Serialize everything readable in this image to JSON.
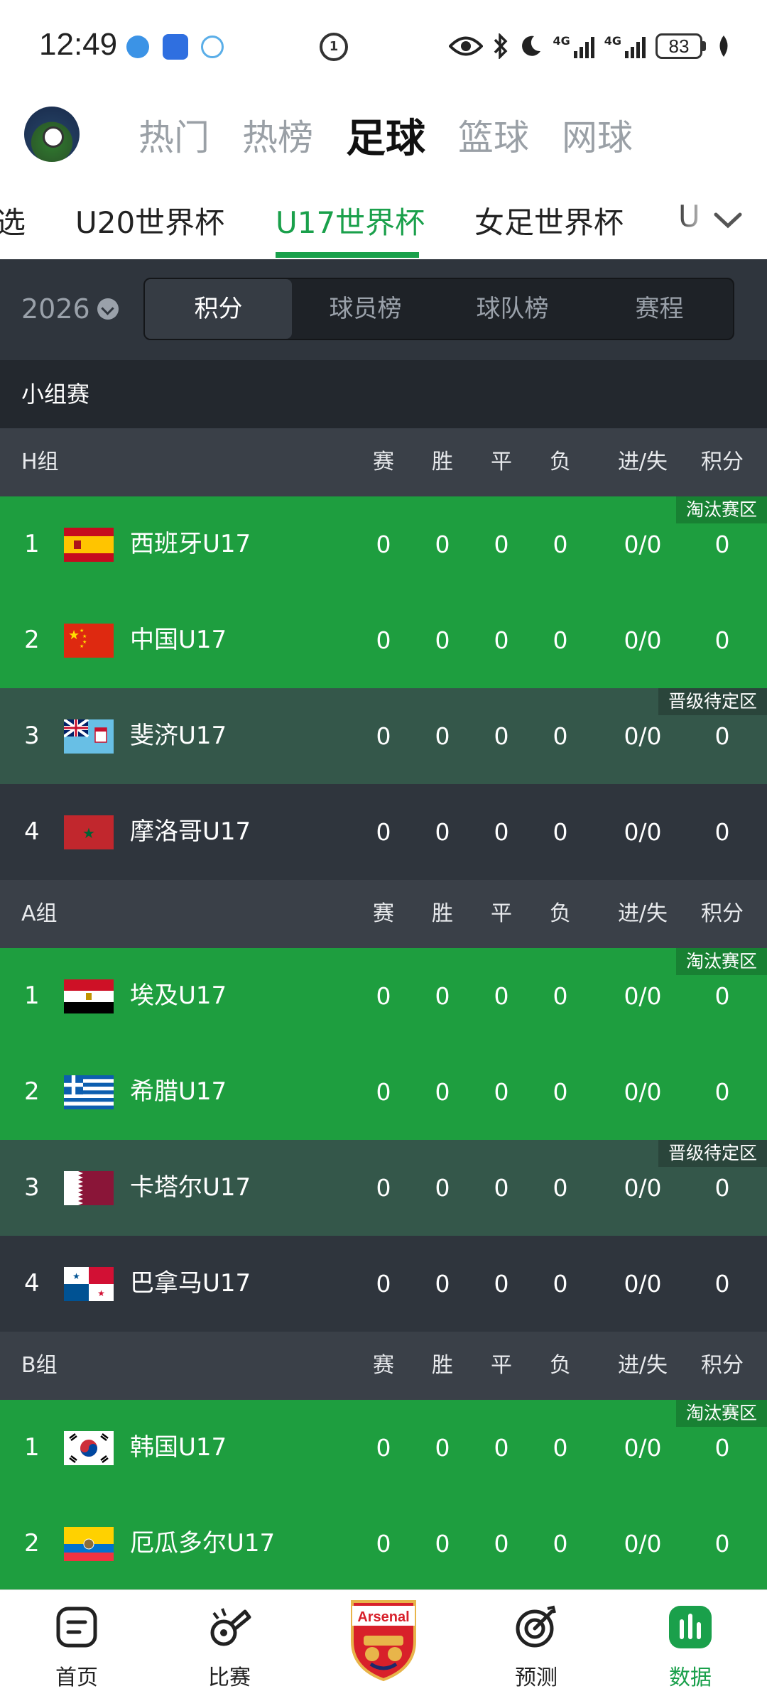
{
  "status_bar": {
    "time": "12:49",
    "battery": "83",
    "network1": "4G",
    "network2": "4G"
  },
  "top_nav": {
    "tabs": [
      {
        "label": "热门",
        "active": false
      },
      {
        "label": "热榜",
        "active": false
      },
      {
        "label": "足球",
        "active": true
      },
      {
        "label": "篮球",
        "active": false
      },
      {
        "label": "网球",
        "active": false
      }
    ]
  },
  "league_tabs": {
    "items": [
      {
        "label": "选",
        "active": false
      },
      {
        "label": "U20世界杯",
        "active": false
      },
      {
        "label": "U17世界杯",
        "active": true
      },
      {
        "label": "女足世界杯",
        "active": false
      },
      {
        "label": "U",
        "active": false
      }
    ]
  },
  "filter": {
    "year": "2026",
    "segments": [
      {
        "label": "积分",
        "active": true
      },
      {
        "label": "球员榜",
        "active": false
      },
      {
        "label": "球队榜",
        "active": false
      },
      {
        "label": "赛程",
        "active": false
      }
    ]
  },
  "standings": {
    "stage": "小组赛",
    "columns": [
      "赛",
      "胜",
      "平",
      "负",
      "进/失",
      "积分"
    ],
    "zones": {
      "knockout": "淘汰赛区",
      "pending": "晋级待定区"
    },
    "groups": [
      {
        "name": "H组",
        "teams": [
          {
            "rank": "1",
            "name": "西班牙U17",
            "flag": "spain",
            "played": "0",
            "won": "0",
            "drawn": "0",
            "lost": "0",
            "goals": "0/0",
            "points": "0",
            "zone": "knockout"
          },
          {
            "rank": "2",
            "name": "中国U17",
            "flag": "china",
            "played": "0",
            "won": "0",
            "drawn": "0",
            "lost": "0",
            "goals": "0/0",
            "points": "0",
            "zone": "knockout"
          },
          {
            "rank": "3",
            "name": "斐济U17",
            "flag": "fiji",
            "played": "0",
            "won": "0",
            "drawn": "0",
            "lost": "0",
            "goals": "0/0",
            "points": "0",
            "zone": "pending"
          },
          {
            "rank": "4",
            "name": "摩洛哥U17",
            "flag": "morocco",
            "played": "0",
            "won": "0",
            "drawn": "0",
            "lost": "0",
            "goals": "0/0",
            "points": "0",
            "zone": "none"
          }
        ]
      },
      {
        "name": "A组",
        "teams": [
          {
            "rank": "1",
            "name": "埃及U17",
            "flag": "egypt",
            "played": "0",
            "won": "0",
            "drawn": "0",
            "lost": "0",
            "goals": "0/0",
            "points": "0",
            "zone": "knockout"
          },
          {
            "rank": "2",
            "name": "希腊U17",
            "flag": "greece",
            "played": "0",
            "won": "0",
            "drawn": "0",
            "lost": "0",
            "goals": "0/0",
            "points": "0",
            "zone": "knockout"
          },
          {
            "rank": "3",
            "name": "卡塔尔U17",
            "flag": "qatar",
            "played": "0",
            "won": "0",
            "drawn": "0",
            "lost": "0",
            "goals": "0/0",
            "points": "0",
            "zone": "pending"
          },
          {
            "rank": "4",
            "name": "巴拿马U17",
            "flag": "panama",
            "played": "0",
            "won": "0",
            "drawn": "0",
            "lost": "0",
            "goals": "0/0",
            "points": "0",
            "zone": "none"
          }
        ]
      },
      {
        "name": "B组",
        "teams": [
          {
            "rank": "1",
            "name": "韩国U17",
            "flag": "korea",
            "played": "0",
            "won": "0",
            "drawn": "0",
            "lost": "0",
            "goals": "0/0",
            "points": "0",
            "zone": "knockout"
          },
          {
            "rank": "2",
            "name": "厄瓜多尔U17",
            "flag": "ecuador",
            "played": "0",
            "won": "0",
            "drawn": "0",
            "lost": "0",
            "goals": "0/0",
            "points": "0",
            "zone": "knockout"
          }
        ]
      }
    ]
  },
  "bottom_nav": {
    "items": [
      {
        "label": "首页",
        "icon": "home-icon",
        "active": false
      },
      {
        "label": "比赛",
        "icon": "whistle-icon",
        "active": false
      },
      {
        "label": "",
        "icon": "arsenal-crest-icon",
        "active": false
      },
      {
        "label": "预测",
        "icon": "target-icon",
        "active": false
      },
      {
        "label": "数据",
        "icon": "data-chart-icon",
        "active": true
      }
    ],
    "crest_text": "Arsenal"
  },
  "colors": {
    "accent_green": "#1aa04b",
    "row_green": "#1e9e3f",
    "row_dark_green": "#34574a",
    "row_dark": "#2f353d"
  }
}
